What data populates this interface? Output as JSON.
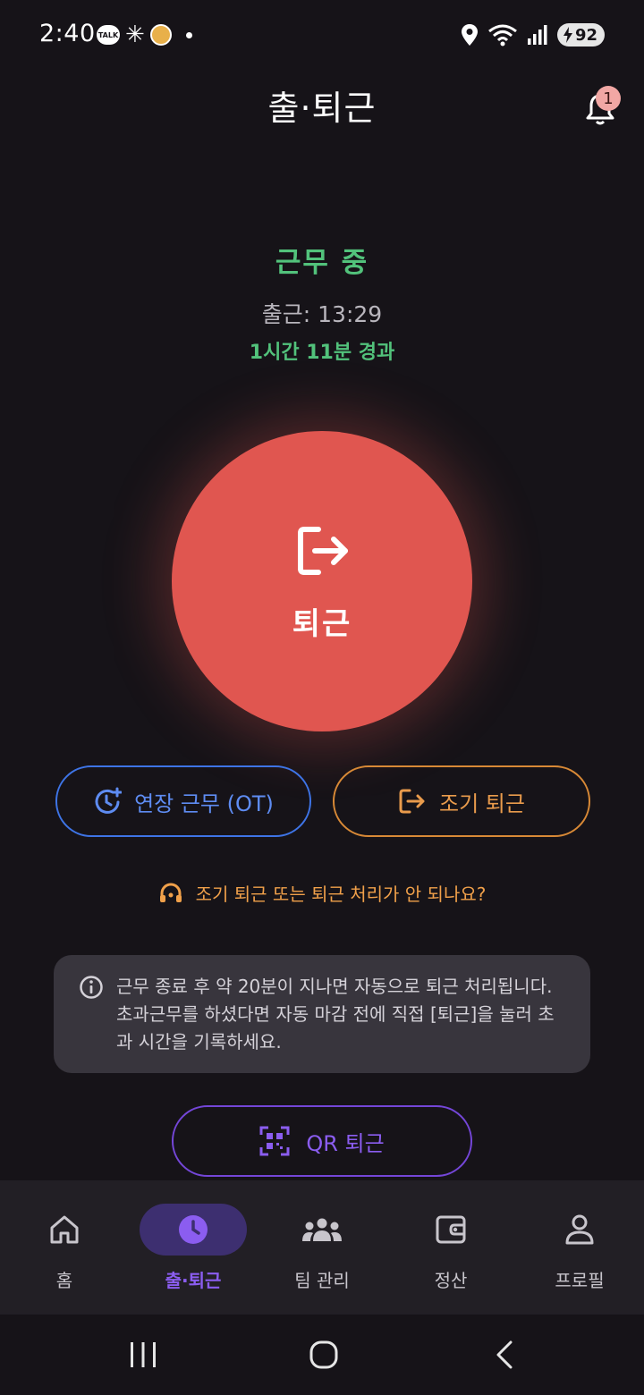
{
  "status_bar": {
    "time": "2:40",
    "talk_label": "TALK",
    "battery": "92"
  },
  "header": {
    "title": "출·퇴근",
    "notification_count": "1"
  },
  "work": {
    "status": "근무 중",
    "clock_in": "출근: 13:29",
    "elapsed": "1시간 11분 경과"
  },
  "main_button": {
    "label": "퇴근"
  },
  "actions": {
    "overtime_label": "연장 근무 (OT)",
    "early_leave_label": "조기 퇴근"
  },
  "help": {
    "text": "조기 퇴근 또는 퇴근 처리가 안 되나요?"
  },
  "info": {
    "line1": "근무 종료 후 약 20분이 지나면 자동으로 퇴근 처리됩니다.",
    "line2": "초과근무를 하셨다면 자동 마감 전에 직접 [퇴근]을 눌러 초",
    "line3": "과 시간을 기록하세요."
  },
  "qr": {
    "label": "QR 퇴근"
  },
  "nav": {
    "items": [
      {
        "label": "홈",
        "icon": "home-icon"
      },
      {
        "label": "출·퇴근",
        "icon": "clock-icon",
        "active": true
      },
      {
        "label": "팀 관리",
        "icon": "team-icon"
      },
      {
        "label": "정산",
        "icon": "wallet-icon"
      },
      {
        "label": "프로필",
        "icon": "profile-icon"
      }
    ]
  },
  "colors": {
    "background": "#161318",
    "working_green": "#52c27b",
    "clockout_red": "#e05650",
    "overtime_blue": "#3e74e6",
    "early_orange": "#d88936",
    "accent_purple": "#7446d8"
  }
}
